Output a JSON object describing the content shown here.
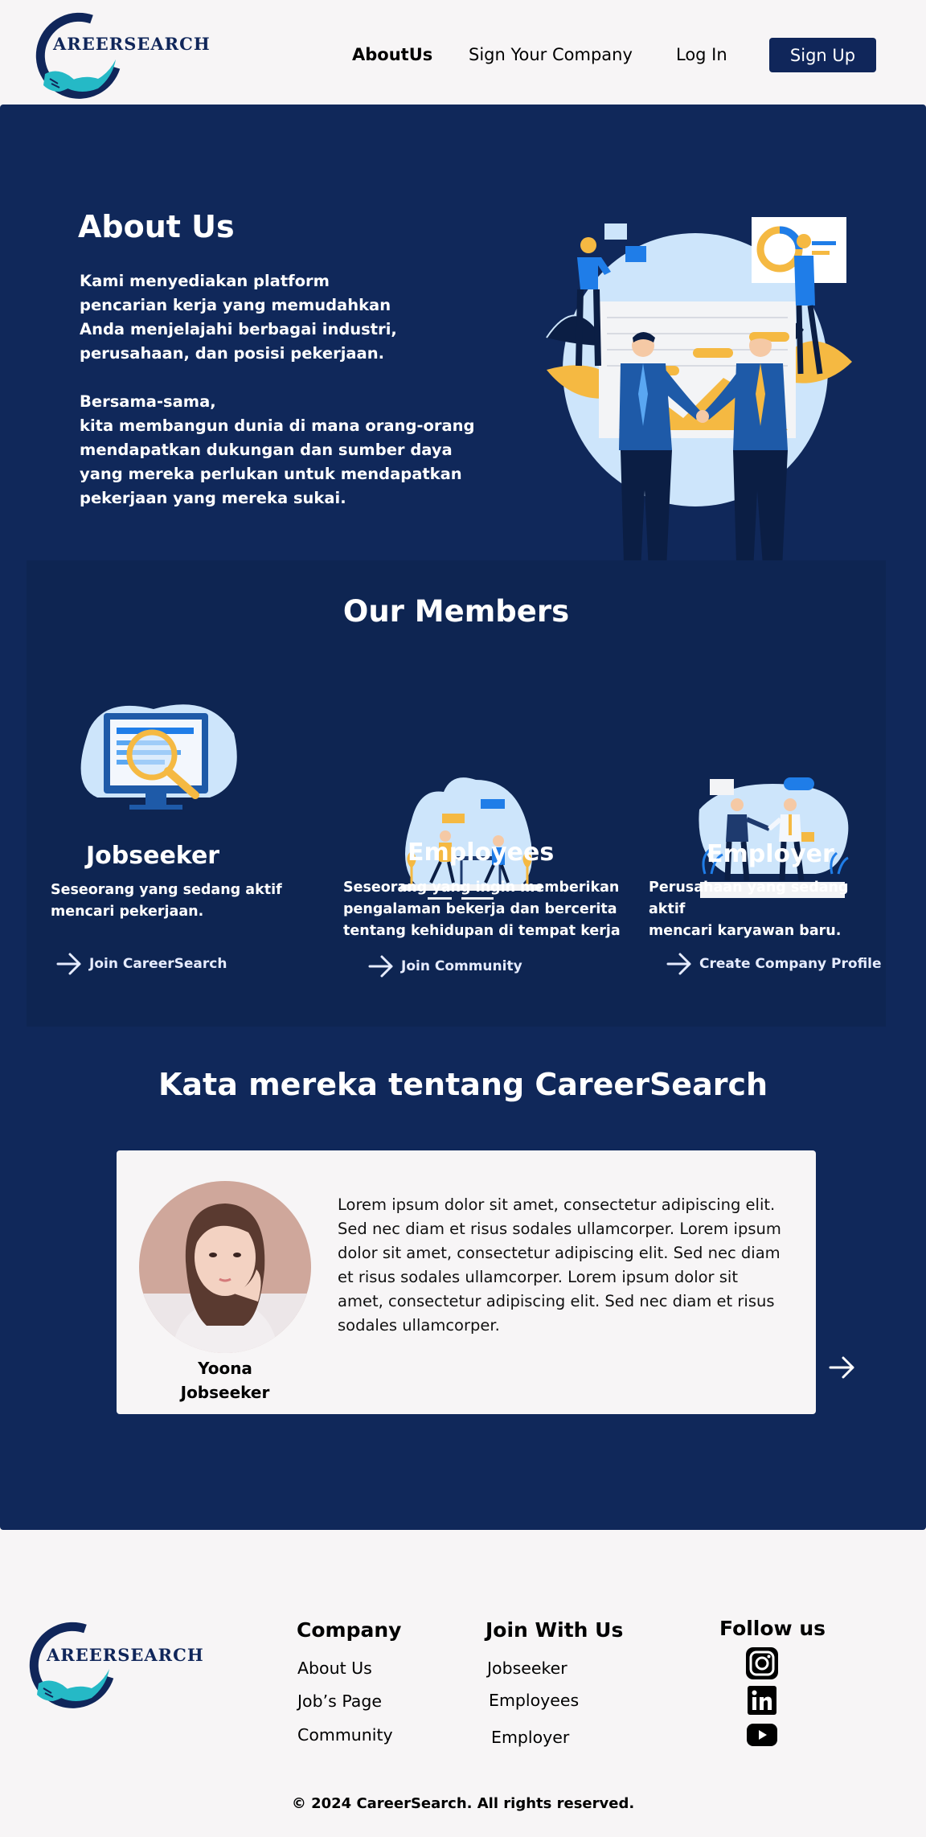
{
  "header": {
    "logo_text": "AREERSEARCH",
    "nav": [
      {
        "label": "AboutUs"
      },
      {
        "label": "Sign Your Company"
      },
      {
        "label": "Log In"
      }
    ],
    "signup_label": "Sign Up"
  },
  "about": {
    "title": "About Us",
    "text": "Kami menyediakan platform\npencarian kerja yang memudahkan\nAnda menjelajahi berbagai industri,\nperusahaan, dan posisi pekerjaan.\n\nBersama-sama,\nkita membangun dunia di mana orang-orang\nmendapatkan dukungan dan sumber daya\nyang mereka perlukan untuk mendapatkan\npekerjaan yang mereka sukai."
  },
  "members": {
    "title": "Our Members",
    "items": [
      {
        "name": "Jobseeker",
        "desc": "Seseorang yang sedang aktif\nmencari pekerjaan.",
        "link": "Join CareerSearch"
      },
      {
        "name": "Employees",
        "desc": "Seseorang yang ingin memberikan\npengalaman bekerja dan bercerita\ntentang kehidupan di tempat kerja",
        "link": "Join Community"
      },
      {
        "name": "Employer",
        "desc": "Perusahaan yang sedang aktif\nmencari karyawan baru.",
        "link": "Create Company Profile"
      }
    ]
  },
  "testimonial": {
    "title": "Kata mereka tentang CareerSearch",
    "name": "Yoona",
    "role": "Jobseeker",
    "text": "Lorem ipsum dolor sit amet, consectetur adipiscing elit. Sed nec diam et risus sodales ullamcorper. Lorem ipsum dolor sit amet, consectetur adipiscing elit. Sed nec diam et risus sodales ullamcorper. Lorem ipsum dolor sit amet, consectetur adipiscing elit. Sed nec diam et risus sodales ullamcorper."
  },
  "footer": {
    "logo_text": "AREERSEARCH",
    "company": {
      "title": "Company",
      "links": [
        "About Us",
        "Job’s Page",
        "Community"
      ]
    },
    "join": {
      "title": "Join With Us",
      "links": [
        "Jobseeker",
        "Employees",
        "Employer"
      ]
    },
    "follow": {
      "title": "Follow us",
      "icons": [
        "instagram-icon",
        "linkedin-icon",
        "youtube-icon"
      ]
    },
    "copyright": "© 2024 CareerSearch. All rights reserved."
  },
  "colors": {
    "navy": "#10285a",
    "accent_yellow": "#f5b942",
    "teal": "#25b9c6",
    "light_blue": "#cde5fb"
  }
}
